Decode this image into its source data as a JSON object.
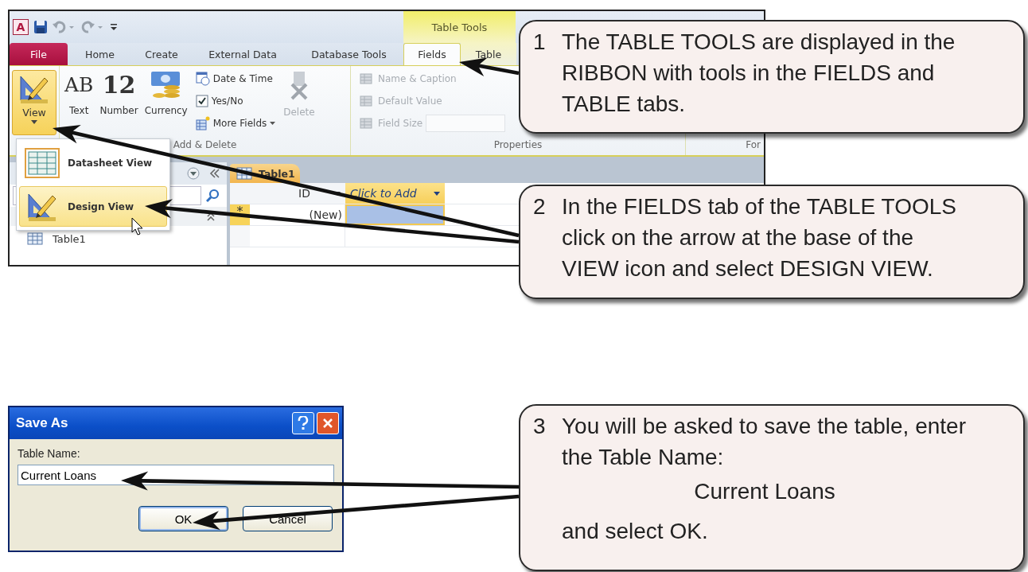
{
  "access": {
    "app_logo": "A",
    "contextual_group": "Table Tools",
    "tabs": [
      {
        "label": "File",
        "kind": "file",
        "selected": false
      },
      {
        "label": "Home",
        "kind": "normal",
        "selected": false
      },
      {
        "label": "Create",
        "kind": "normal",
        "selected": false
      },
      {
        "label": "External Data",
        "kind": "normal",
        "selected": false
      },
      {
        "label": "Database Tools",
        "kind": "normal",
        "selected": false
      },
      {
        "label": "Fields",
        "kind": "contextual",
        "selected": true
      },
      {
        "label": "Table",
        "kind": "contextual",
        "selected": false
      }
    ],
    "view_button": {
      "label": "View"
    },
    "add_delete": {
      "title": "Add & Delete",
      "large": [
        {
          "kind": "glyph",
          "glyph": "AB",
          "label": "Text"
        },
        {
          "kind": "glyph",
          "glyph": "12",
          "label": "Number"
        },
        {
          "kind": "currency",
          "label": "Currency"
        }
      ],
      "small": [
        {
          "kind": "datetime",
          "label": "Date & Time"
        },
        {
          "kind": "check",
          "label": "Yes/No"
        },
        {
          "kind": "more",
          "label": "More Fields"
        }
      ],
      "delete": {
        "label": "Delete",
        "disabled": true
      }
    },
    "properties": {
      "title": "Properties",
      "items": [
        {
          "kind": "name",
          "label": "Name & Caption",
          "disabled": true
        },
        {
          "kind": "default",
          "label": "Default Value",
          "disabled": true
        },
        {
          "kind": "size",
          "label": "Field Size",
          "disabled": true
        }
      ]
    },
    "next_group_title": "For",
    "view_menu": [
      {
        "kind": "datasheet",
        "label": "Datasheet View",
        "selected": false
      },
      {
        "kind": "design",
        "label": "Design View",
        "selected": true
      }
    ],
    "nav_pane": {
      "items": [
        {
          "label": "Table1"
        }
      ]
    },
    "document_tab": "Table1",
    "datasheet": {
      "columns": [
        {
          "label": "ID",
          "kind": "field"
        },
        {
          "label": "Click to Add",
          "kind": "add"
        }
      ],
      "new_row": {
        "marker": "*",
        "id": "(New)"
      }
    }
  },
  "dialog": {
    "title": "Save As",
    "field_label": "Table Name:",
    "value": "Current Loans",
    "buttons": [
      {
        "label": "OK",
        "kind": "default"
      },
      {
        "label": "Cancel",
        "kind": "normal"
      }
    ]
  },
  "callouts": [
    {
      "number": "1",
      "paragraphs": [
        {
          "kind": "text",
          "text": "The TABLE TOOLS are displayed in the RIBBON with tools in the FIELDS and TABLE tabs."
        }
      ]
    },
    {
      "number": "2",
      "paragraphs": [
        {
          "kind": "text",
          "text": "In the FIELDS tab of the TABLE TOOLS click on the arrow at the base of the VIEW icon and select DESIGN VIEW."
        }
      ]
    },
    {
      "number": "3",
      "paragraphs": [
        {
          "kind": "text",
          "text": "You will be asked to save the table, enter the Table Name:"
        },
        {
          "kind": "centered",
          "text": "Current Loans"
        },
        {
          "kind": "text",
          "text": "and select OK."
        }
      ]
    }
  ]
}
